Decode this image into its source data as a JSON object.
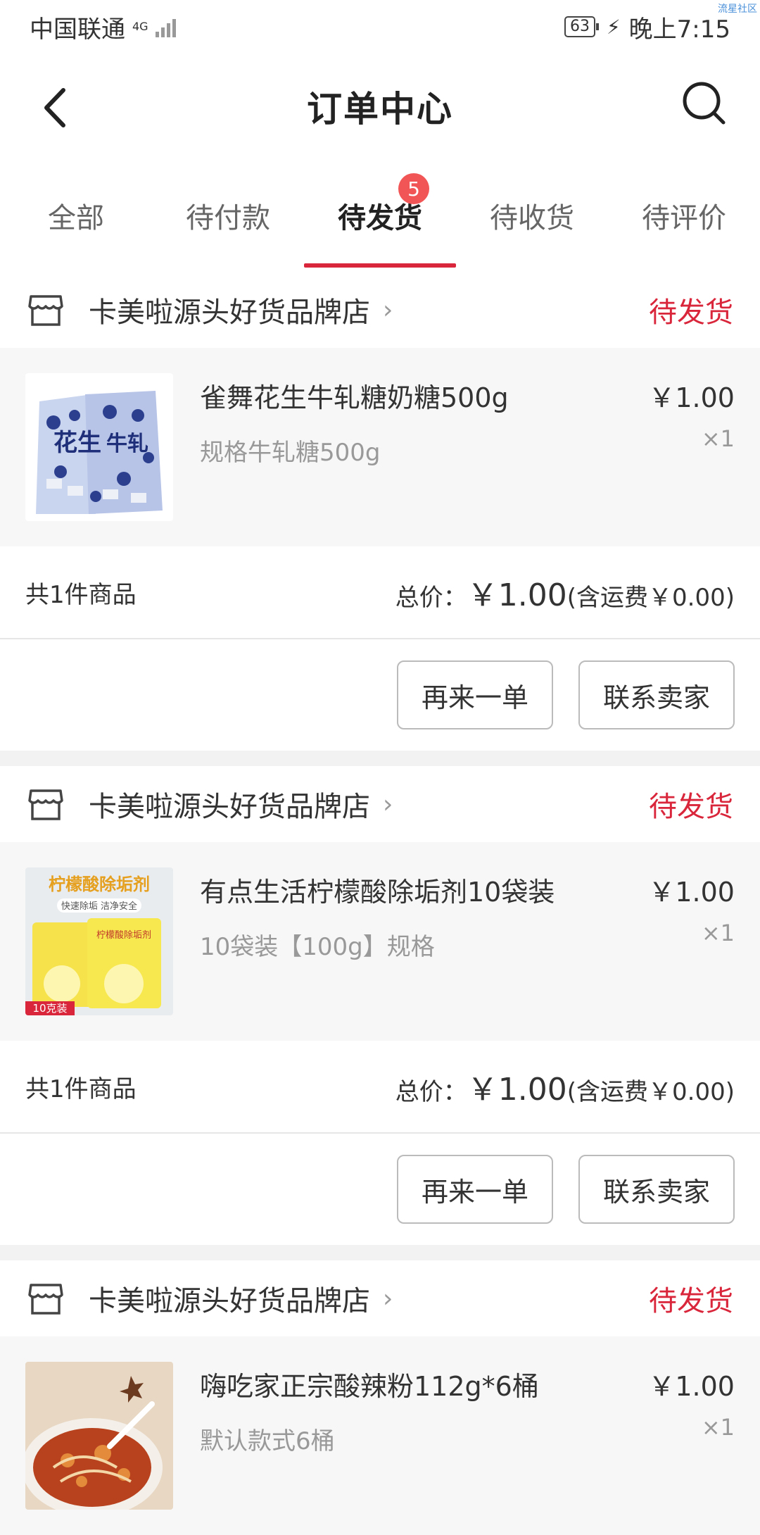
{
  "status_bar": {
    "carrier": "中国联通",
    "network": "4G",
    "battery": "63",
    "time": "晚上7:15",
    "watermark": "流星社区"
  },
  "header": {
    "title": "订单中心"
  },
  "tabs": [
    {
      "label": "全部"
    },
    {
      "label": "待付款"
    },
    {
      "label": "待发货",
      "badge": "5"
    },
    {
      "label": "待收货"
    },
    {
      "label": "待评价"
    }
  ],
  "orders": [
    {
      "shop": "卡美啦源头好货品牌店",
      "status": "待发货",
      "product_title": "雀舞花生牛轧糖奶糖500g",
      "product_spec": "规格牛轧糖500g",
      "price": "￥1.00",
      "qty": "×1",
      "count": "共1件商品",
      "total_label": "总价：",
      "total": "￥1.00",
      "shipping": "(含运费￥0.00)",
      "btn_again": "再来一单",
      "btn_contact": "联系卖家"
    },
    {
      "shop": "卡美啦源头好货品牌店",
      "status": "待发货",
      "product_title": "有点生活柠檬酸除垢剂10袋装",
      "product_spec": "10袋装【100g】规格",
      "thumb_text": "柠檬酸除垢剂",
      "thumb_sub": "快速除垢 洁净安全",
      "thumb_tag": "10克装",
      "price": "￥1.00",
      "qty": "×1",
      "count": "共1件商品",
      "total_label": "总价：",
      "total": "￥1.00",
      "shipping": "(含运费￥0.00)",
      "btn_again": "再来一单",
      "btn_contact": "联系卖家"
    },
    {
      "shop": "卡美啦源头好货品牌店",
      "status": "待发货",
      "product_title": "嗨吃家正宗酸辣粉112g*6桶",
      "product_spec": "默认款式6桶",
      "price": "￥1.00",
      "qty": "×1"
    }
  ]
}
